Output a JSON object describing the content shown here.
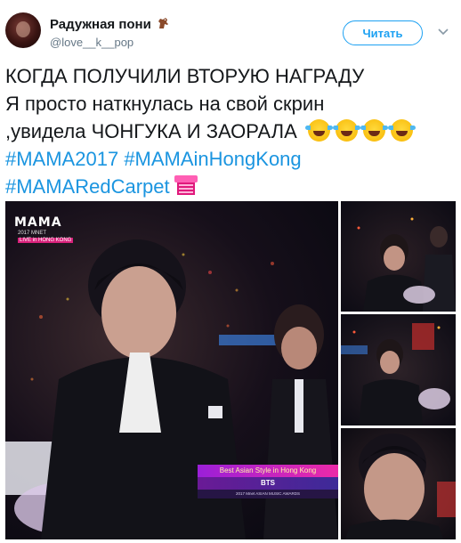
{
  "user": {
    "display_name": "Радужная пони",
    "handle": "@love__k__pop",
    "avatar_icon": "avatar-photo",
    "name_icon": "horse-icon"
  },
  "actions": {
    "follow_label": "Читать",
    "menu_icon": "chevron-down-icon"
  },
  "tweet": {
    "line1": "КОГДА ПОЛУЧИЛИ ВТОРУЮ НАГРАДУ",
    "line2": "Я просто наткнулась на свой скрин",
    "line3": ",увидела ЧОНГУКА И ЗАОРАЛА",
    "emoji_icon": "face-with-tears-of-joy-icon",
    "emoji_count": 4,
    "hashtags_line1": [
      "#MAMA2017",
      "#MAMAinHongKong"
    ],
    "hashtags_line2": [
      "#MAMARedCarpet"
    ],
    "sticker_icon": "mama-sticker-icon"
  },
  "media": {
    "main_photo": {
      "logo_title": "MAMA",
      "logo_sub": "2017 MNET",
      "logo_live": "LIVE in HONG KONG",
      "caption_award": "Best Asian Style in Hong Kong",
      "caption_name": "BTS",
      "caption_event": "2017 Mnet ASIAN MUSIC AWARDS"
    },
    "thumbnails": 3
  },
  "colors": {
    "accent": "#1da1f2",
    "hashtag": "#1b95e0",
    "text": "#14171a",
    "secondary_text": "#657786"
  }
}
